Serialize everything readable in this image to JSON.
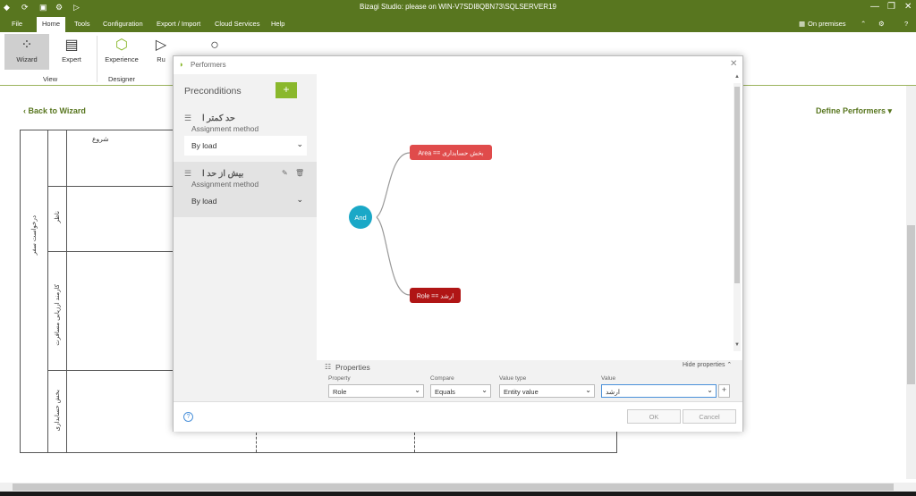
{
  "window": {
    "title": "Bizagi Studio: please  on WIN-V7SDI8QBN73\\SQLSERVER19"
  },
  "menu": {
    "items": [
      "File",
      "Home",
      "Tools",
      "Configuration",
      "Export / Import",
      "Cloud Services",
      "Help"
    ],
    "right_label": "On premises"
  },
  "ribbon": {
    "wizard": "Wizard",
    "expert": "Expert",
    "experience": "Experience",
    "run": "Ru",
    "view_group": "View",
    "designer_group": "Designer"
  },
  "page": {
    "back": "Back to Wizard",
    "define": "Define Performers"
  },
  "lanes": {
    "pool": "درخواست سفر",
    "lane1": "ناظر",
    "lane2": "کارمند ارزیابی مسافرت",
    "lane3": "بخش حسابداری",
    "task": "شروع"
  },
  "dialog": {
    "title": "Performers",
    "preconditions": "Preconditions",
    "cards": [
      {
        "name": "حد کمتر ا",
        "sub": "Assignment method",
        "value": "By load"
      },
      {
        "name": "بیش از حد ا",
        "sub": "Assignment method",
        "value": "By load"
      }
    ],
    "graph": {
      "and_node": "And",
      "area_node": "Area == بخش حسابداری",
      "role_node": "Role == ارشد"
    },
    "properties": {
      "title": "Properties",
      "hide": "Hide properties",
      "labels": [
        "Property",
        "Compare",
        "Value type",
        "Value"
      ],
      "values": [
        "Role",
        "Equals",
        "Entity value",
        "ارشد"
      ]
    },
    "ok": "OK",
    "cancel": "Cancel"
  },
  "colors": {
    "brand": "#58761f",
    "and_node": "#1aa8c7",
    "area_node": "#e04b4b",
    "role_node": "#b01515"
  }
}
